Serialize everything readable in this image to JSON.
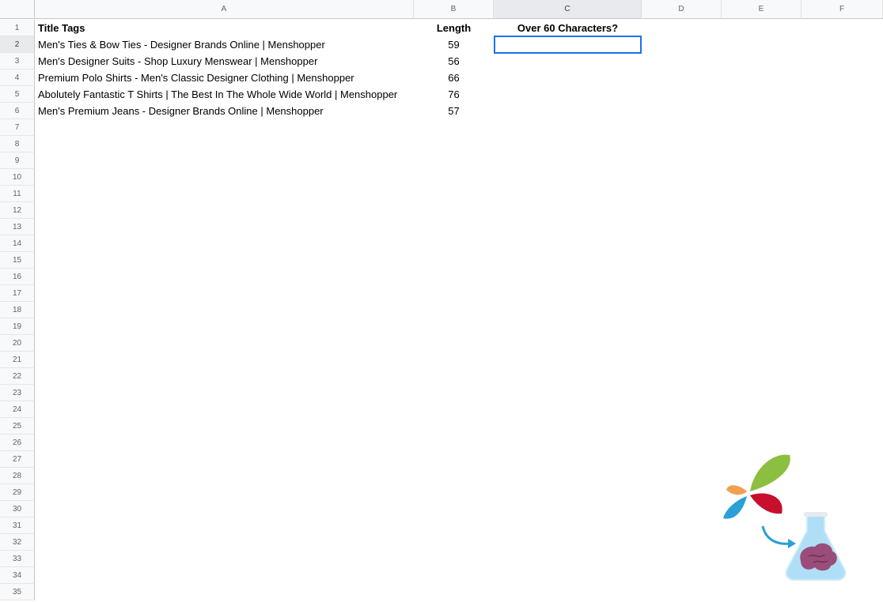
{
  "columns": [
    "A",
    "B",
    "C",
    "D",
    "E",
    "F"
  ],
  "rows": [
    "1",
    "2",
    "3",
    "4",
    "5",
    "6",
    "7",
    "8",
    "9",
    "10",
    "11",
    "12",
    "13",
    "14",
    "15",
    "16",
    "17",
    "18",
    "19",
    "20",
    "21",
    "22",
    "23",
    "24",
    "25",
    "26",
    "27",
    "28",
    "29",
    "30",
    "31",
    "32",
    "33",
    "34",
    "35"
  ],
  "headers": {
    "title_tags": "Title Tags",
    "length": "Length",
    "over_60": "Over 60 Characters?"
  },
  "data_rows": [
    {
      "title": "Men's Ties & Bow Ties - Designer Brands Online | Menshopper",
      "length": "59"
    },
    {
      "title": "Men's Designer Suits - Shop Luxury Menswear | Menshopper",
      "length": "56"
    },
    {
      "title": "Premium Polo Shirts - Men's Classic Designer Clothing | Menshopper",
      "length": "66"
    },
    {
      "title": "Abolutely Fantastic T Shirts | The Best In The Whole Wide World | Menshopper",
      "length": "76"
    },
    {
      "title": "Men's Premium Jeans - Designer Brands Online | Menshopper",
      "length": "57"
    }
  ],
  "selected_cell": "C2",
  "logo_icon": "flask-brain-logo-icon",
  "colors": {
    "selection": "#1a73e8",
    "header_bg": "#f8f9fa",
    "logo_green": "#8cbf3f",
    "logo_red": "#c8102e",
    "logo_orange": "#f0a050",
    "logo_blue": "#2a9fd8",
    "flask_blue": "#6cc4ee",
    "brain_purple": "#9a4d7a"
  }
}
